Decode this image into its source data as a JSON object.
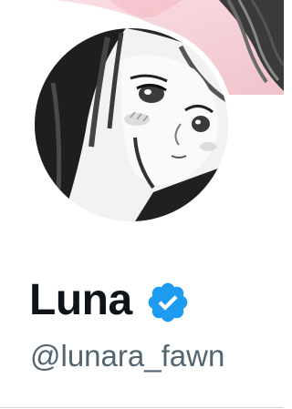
{
  "profile": {
    "display_name": "Luna",
    "handle": "@lunara_fawn",
    "verified": true
  },
  "icons": {
    "verified": "verified-badge-icon"
  },
  "colors": {
    "verified_blue": "#1d9bf0",
    "name_text": "#0f1419",
    "handle_text": "#536471",
    "banner_pink": "#f6d3da"
  }
}
